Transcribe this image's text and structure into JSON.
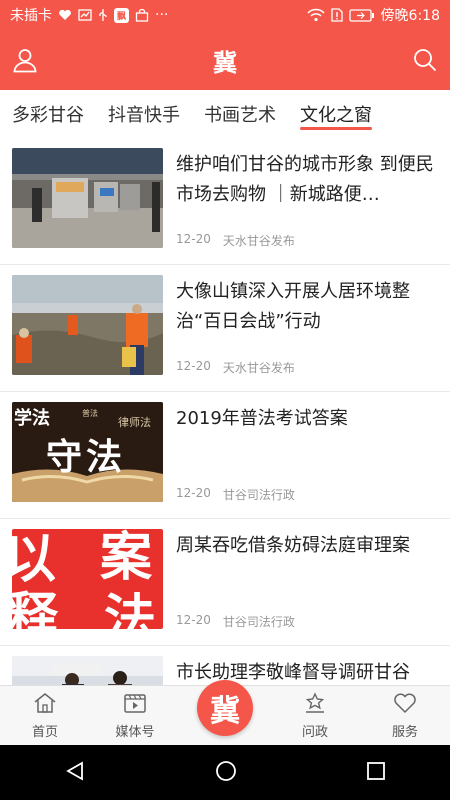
{
  "status_bar": {
    "carrier": "未插卡",
    "time": "傍晚6:18",
    "badge_label": "飘",
    "more": "···"
  },
  "header": {
    "title": "冀"
  },
  "tabs": [
    {
      "label": "多彩甘谷",
      "active": false
    },
    {
      "label": "抖音快手",
      "active": false
    },
    {
      "label": "书画艺术",
      "active": false
    },
    {
      "label": "文化之窗",
      "active": true
    }
  ],
  "articles": [
    {
      "title": "维护咱们甘谷的城市形象 到便民市场去购物 ｜新城路便…",
      "date": "12-20",
      "source": "天水甘谷发布"
    },
    {
      "title": "大像山镇深入开展人居环境整治“百日会战”行动",
      "date": "12-20",
      "source": "天水甘谷发布"
    },
    {
      "title": "2019年普法考试答案",
      "date": "12-20",
      "source": "甘谷司法行政",
      "thumb_text": {
        "top_left": "学法",
        "top_mid": "普法",
        "top_right": "律师法",
        "center": "守法"
      }
    },
    {
      "title": "周某吞吃借条妨碍法庭审理案",
      "date": "12-20",
      "source": "甘谷司法行政",
      "thumb_text": {
        "a": "以",
        "b": "案",
        "c": "释",
        "d": "法"
      }
    },
    {
      "title": "市长助理李敬峰督导调研甘谷",
      "date": "",
      "source": ""
    }
  ],
  "bottom_nav": {
    "home": "首页",
    "media": "媒体号",
    "center": "冀",
    "ask": "问政",
    "service": "服务"
  },
  "colors": {
    "brand": "#f4574a",
    "meta": "#999999"
  }
}
